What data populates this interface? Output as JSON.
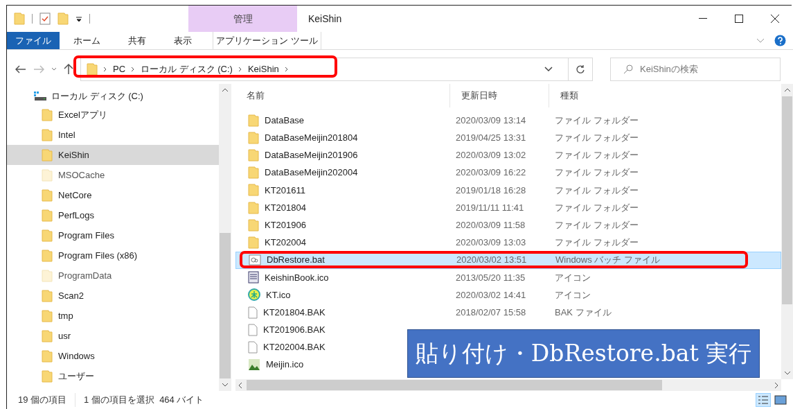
{
  "window": {
    "title": "KeiShin",
    "context_tab": "管理"
  },
  "ribbon_tabs": [
    {
      "label": "ファイル",
      "kind": "file",
      "selected": false
    },
    {
      "label": "ホーム",
      "kind": "tab",
      "selected": false
    },
    {
      "label": "共有",
      "kind": "tab",
      "selected": false
    },
    {
      "label": "表示",
      "kind": "tab",
      "selected": false
    },
    {
      "label": "アプリケーション ツール",
      "kind": "context",
      "selected": false
    }
  ],
  "address": {
    "crumbs": [
      "PC",
      "ローカル ディスク (C:)",
      "KeiShin"
    ]
  },
  "search": {
    "placeholder": "KeiShinの検索"
  },
  "sidebar": {
    "drive": "ローカル ディスク (C:)",
    "items": [
      {
        "label": "Excelアプリ",
        "selected": false,
        "hidden": false
      },
      {
        "label": "Intel",
        "selected": false,
        "hidden": false
      },
      {
        "label": "KeiShin",
        "selected": true,
        "hidden": false
      },
      {
        "label": "MSOCache",
        "selected": false,
        "hidden": true
      },
      {
        "label": "NetCore",
        "selected": false,
        "hidden": false
      },
      {
        "label": "PerfLogs",
        "selected": false,
        "hidden": false
      },
      {
        "label": "Program Files",
        "selected": false,
        "hidden": false
      },
      {
        "label": "Program Files (x86)",
        "selected": false,
        "hidden": false
      },
      {
        "label": "ProgramData",
        "selected": false,
        "hidden": true
      },
      {
        "label": "Scan2",
        "selected": false,
        "hidden": false
      },
      {
        "label": "tmp",
        "selected": false,
        "hidden": false
      },
      {
        "label": "usr",
        "selected": false,
        "hidden": false
      },
      {
        "label": "Windows",
        "selected": false,
        "hidden": false
      },
      {
        "label": "ユーザー",
        "selected": false,
        "hidden": false
      }
    ]
  },
  "table": {
    "columns": [
      "名前",
      "更新日時",
      "種類"
    ],
    "rows": [
      {
        "name": "DataBase",
        "date": "2020/03/09 13:14",
        "type": "ファイル フォルダー",
        "kind": "folder",
        "selected": false
      },
      {
        "name": "DataBaseMeijin201804",
        "date": "2019/04/25 13:31",
        "type": "ファイル フォルダー",
        "kind": "folder",
        "selected": false
      },
      {
        "name": "DataBaseMeijin201906",
        "date": "2020/03/09 13:02",
        "type": "ファイル フォルダー",
        "kind": "folder",
        "selected": false
      },
      {
        "name": "DataBaseMeijin202004",
        "date": "2020/03/09 16:22",
        "type": "ファイル フォルダー",
        "kind": "folder",
        "selected": false
      },
      {
        "name": "KT201611",
        "date": "2019/01/18 16:28",
        "type": "ファイル フォルダー",
        "kind": "folder",
        "selected": false
      },
      {
        "name": "KT201804",
        "date": "2019/11/11 11:41",
        "type": "ファイル フォルダー",
        "kind": "folder",
        "selected": false
      },
      {
        "name": "KT201906",
        "date": "2020/03/09 11:58",
        "type": "ファイル フォルダー",
        "kind": "folder",
        "selected": false
      },
      {
        "name": "KT202004",
        "date": "2020/03/09 13:03",
        "type": "ファイル フォルダー",
        "kind": "folder",
        "selected": false
      },
      {
        "name": "DbRestore.bat",
        "date": "2020/03/02 13:51",
        "type": "Windows バッチ ファイル",
        "kind": "batch",
        "selected": true
      },
      {
        "name": "KeishinBook.ico",
        "date": "2013/05/20 11:35",
        "type": "アイコン",
        "kind": "book",
        "selected": false
      },
      {
        "name": "KT.ico",
        "date": "2020/03/02 14:41",
        "type": "アイコン",
        "kind": "badge",
        "selected": false
      },
      {
        "name": "KT201804.BAK",
        "date": "2018/02/07 15:58",
        "type": "BAK ファイル",
        "kind": "file",
        "selected": false
      },
      {
        "name": "KT201906.BAK",
        "kind": "file",
        "selected": false
      },
      {
        "name": "KT202004.BAK",
        "kind": "file",
        "selected": false
      },
      {
        "name": "Meijin.ico",
        "kind": "picture",
        "selected": false
      }
    ]
  },
  "status_bar": {
    "count": "19 個の項目",
    "selection": "1 個の項目を選択  464 バイト"
  },
  "callout": {
    "text": "貼り付け・DbRestore.bat 実行"
  }
}
